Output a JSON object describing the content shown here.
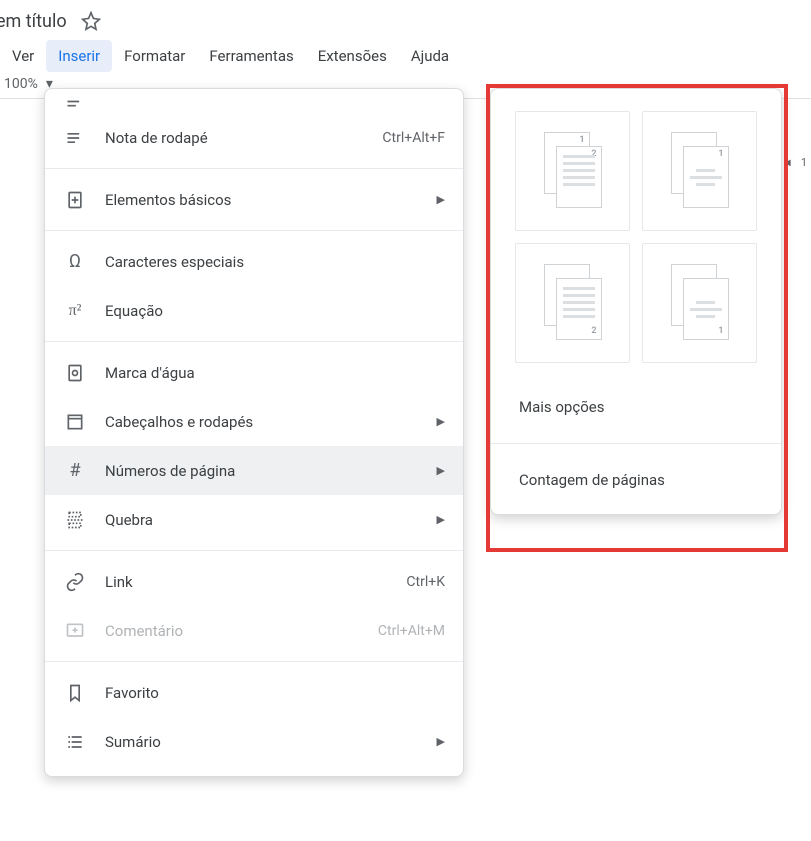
{
  "doc": {
    "title_fragment": "em título"
  },
  "menubar": {
    "view": "Ver",
    "insert": "Inserir",
    "format": "Formatar",
    "tools": "Ferramentas",
    "extensions": "Extensões",
    "help": "Ajuda"
  },
  "toolbar": {
    "zoom": "100%"
  },
  "insert_menu": {
    "dropdown_cut": "",
    "footnote": {
      "label": "Nota de rodapé",
      "shortcut": "Ctrl+Alt+F"
    },
    "building_blocks": "Elementos básicos",
    "special_chars": "Caracteres especiais",
    "equation": "Equação",
    "watermark": "Marca d'água",
    "headers_footers": "Cabeçalhos e rodapés",
    "page_numbers": "Números de página",
    "break": "Quebra",
    "link": {
      "label": "Link",
      "shortcut": "Ctrl+K"
    },
    "comment": {
      "label": "Comentário",
      "shortcut": "Ctrl+Alt+M"
    },
    "bookmark": "Favorito",
    "toc": "Sumário"
  },
  "page_numbers_submenu": {
    "more_options": "Mais opções",
    "page_count": "Contagem de páginas"
  },
  "ruler_snippet": "1"
}
